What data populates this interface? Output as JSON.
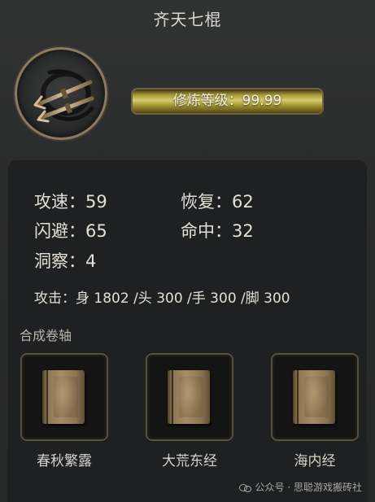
{
  "header": {
    "title": "齐天七棍"
  },
  "emblem": {
    "icon": "crossed-staves-icon"
  },
  "level": {
    "label": "修炼等级：99.99"
  },
  "stats": {
    "attack_speed": "攻速：59",
    "recovery": "恢复：62",
    "dodge": "闪避：65",
    "accuracy": "命中：32",
    "insight": "洞察：4"
  },
  "attack": {
    "text": "攻击：身 1802 /头 300 /手 300 /脚 300"
  },
  "scrolls": {
    "section_label": "合成卷轴",
    "items": [
      {
        "label": "春秋繁露",
        "icon": "book-icon"
      },
      {
        "label": "大荒东经",
        "icon": "book-icon"
      },
      {
        "label": "海内经",
        "icon": "book-icon"
      }
    ]
  },
  "watermark": {
    "text": "公众号 · 思聪游戏搬砖社"
  },
  "colors": {
    "panel": "#2b2c2c",
    "inner": "#1f2021",
    "gold": "#d7cc6c",
    "frame": "#8a7b5e",
    "text": "#e3e0d6"
  }
}
